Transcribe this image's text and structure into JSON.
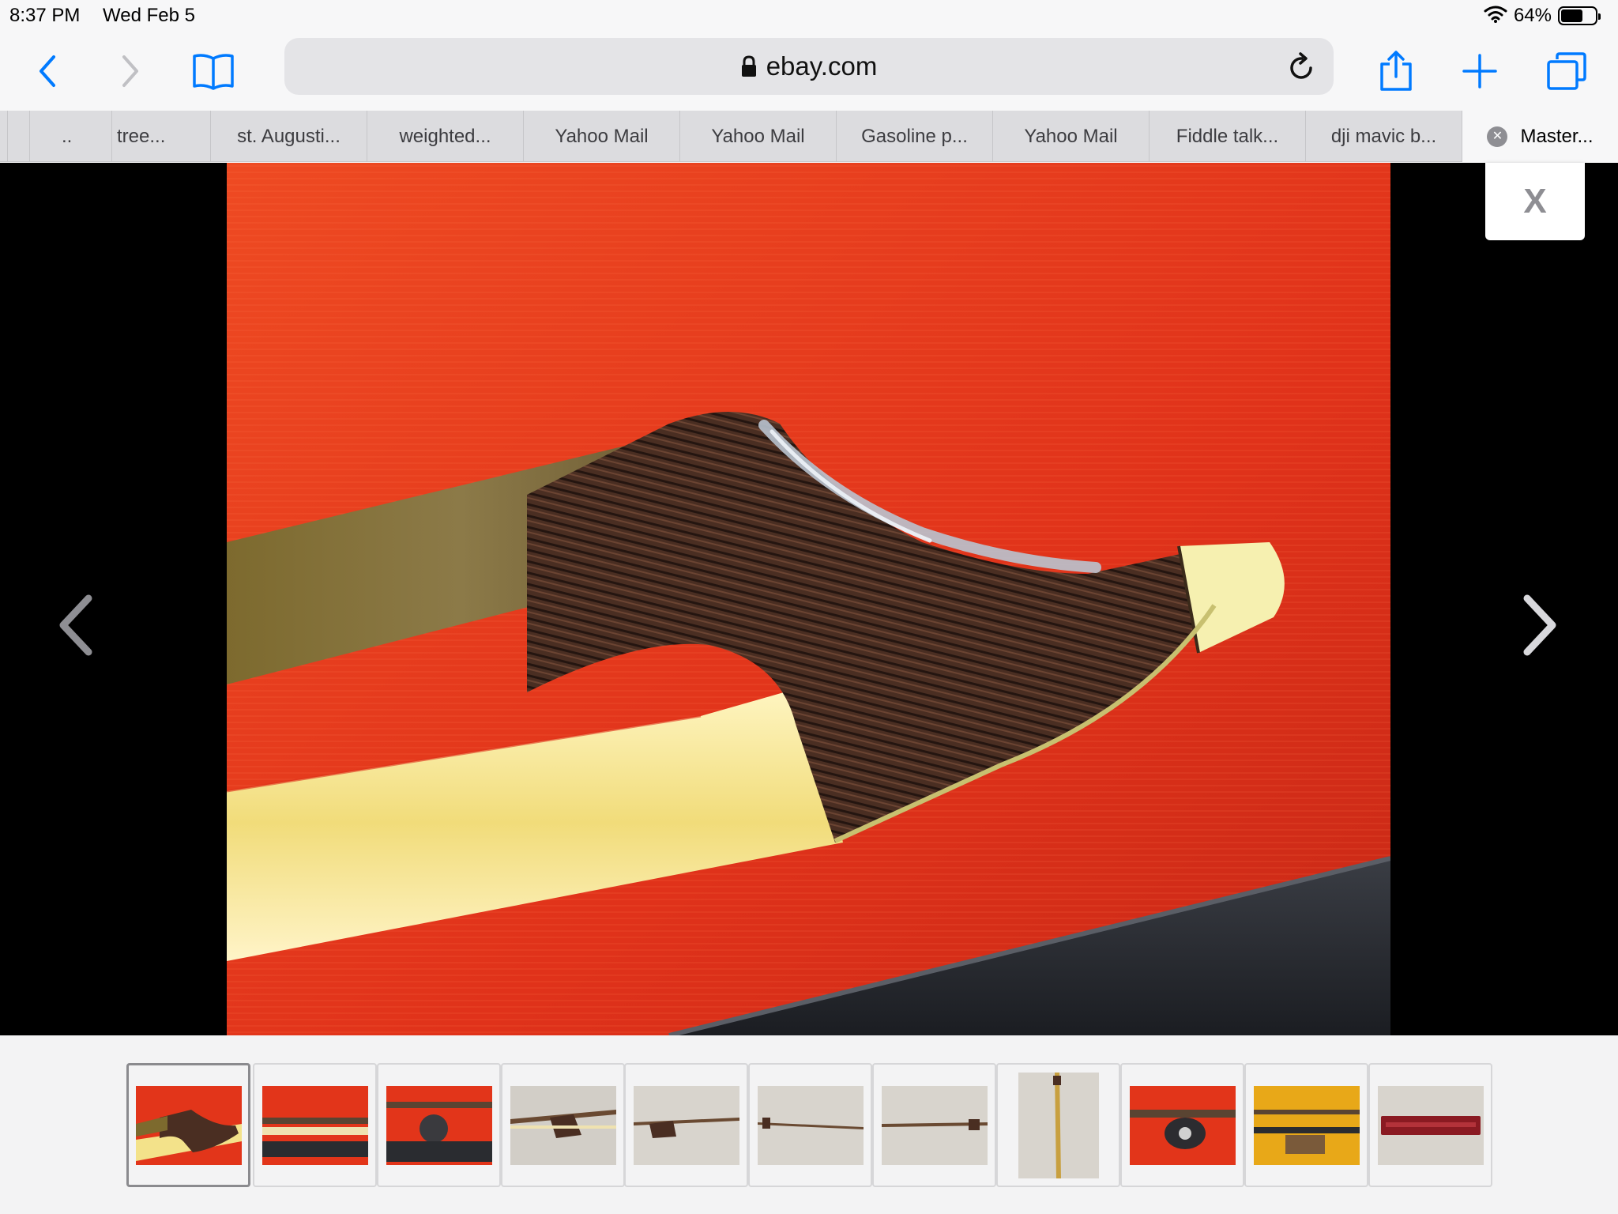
{
  "status_bar": {
    "time": "8:37 PM",
    "date": "Wed Feb 5",
    "battery_percent": "64%",
    "battery_level": 0.64
  },
  "browser": {
    "url": "ebay.com",
    "tabs": [
      {
        "label": ".."
      },
      {
        "label": "tree..."
      },
      {
        "label": "st. Augusti..."
      },
      {
        "label": "weighted..."
      },
      {
        "label": "Yahoo Mail"
      },
      {
        "label": "Yahoo Mail"
      },
      {
        "label": "Gasoline p..."
      },
      {
        "label": "Yahoo Mail"
      },
      {
        "label": "Fiddle talk..."
      },
      {
        "label": "dji mavic b..."
      },
      {
        "label": "Master...",
        "active": true
      }
    ]
  },
  "viewer": {
    "close_label": "X",
    "photo_subject": "violin bow frog on red cloth",
    "thumbnail_count": 11,
    "selected_thumbnail": 1
  },
  "icons": {
    "back": "chevron-left-icon",
    "forward": "chevron-right-icon",
    "bookmarks": "book-icon",
    "lock": "lock-icon",
    "reload": "reload-icon",
    "share": "share-icon",
    "new_tab": "plus-icon",
    "tabs": "tabs-icon",
    "wifi": "wifi-icon"
  },
  "colors": {
    "accent": "#007aff",
    "photo_bg": "#e63a1a"
  }
}
